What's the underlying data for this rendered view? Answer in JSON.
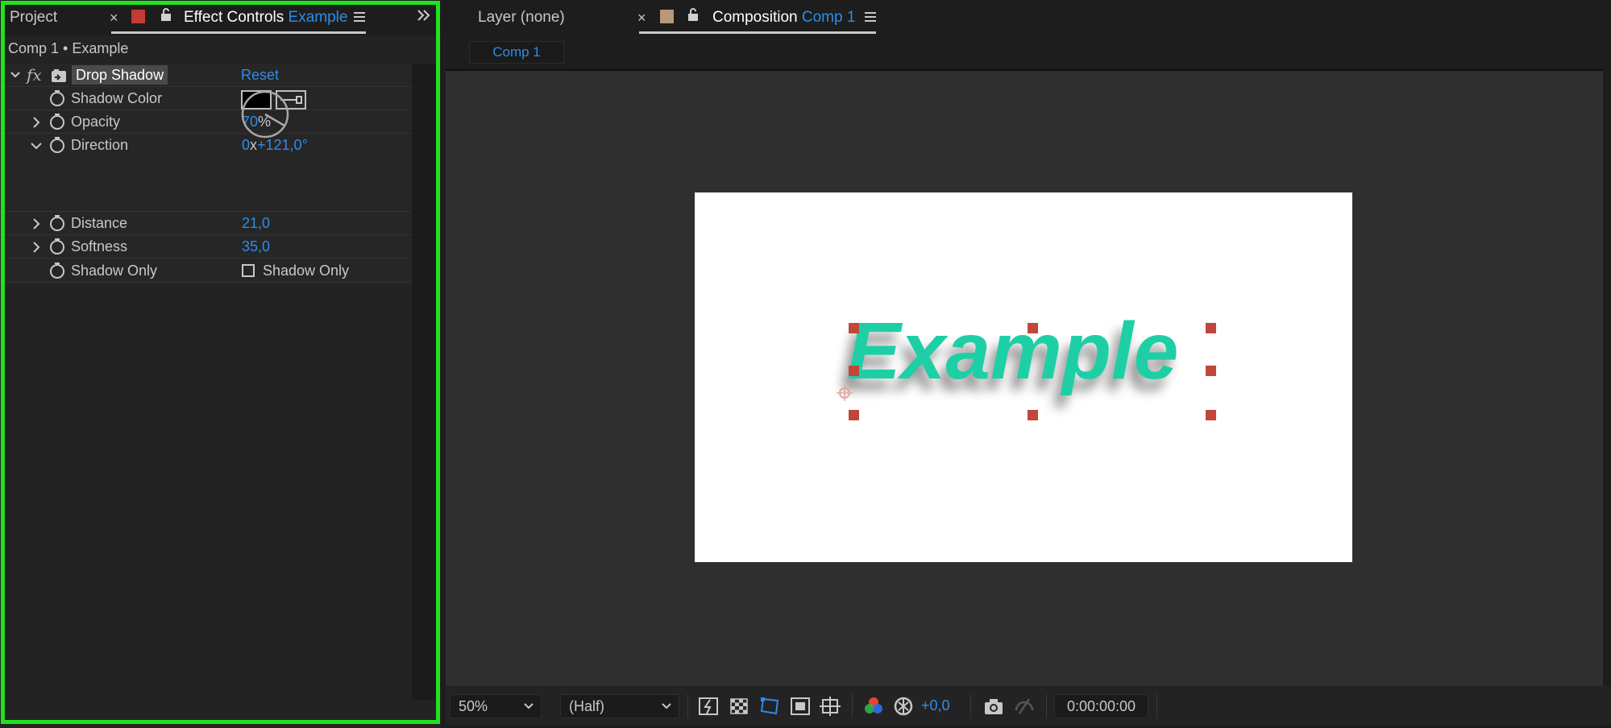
{
  "left_panel": {
    "tabs": {
      "project": "Project",
      "effect_controls": "Effect Controls",
      "effect_layer": "Example"
    },
    "comp_path": "Comp 1 • Example",
    "effect": {
      "name": "Drop Shadow",
      "reset": "Reset",
      "fx": "fx"
    },
    "properties": {
      "shadow_color": "Shadow Color",
      "opacity": {
        "label": "Opacity",
        "value": "70",
        "unit": "%"
      },
      "direction": {
        "label": "Direction",
        "revolutions": "0",
        "x": "x",
        "degrees": "+121,0°"
      },
      "distance": {
        "label": "Distance",
        "value": "21,0"
      },
      "softness": {
        "label": "Softness",
        "value": "35,0"
      },
      "shadow_only": {
        "label": "Shadow Only",
        "checkbox_label": "Shadow Only"
      }
    }
  },
  "right_panel": {
    "tabs": {
      "layer": "Layer (none)",
      "composition": "Composition",
      "comp_name": "Comp 1"
    },
    "sub_tab": "Comp 1",
    "canvas_text": "Example",
    "bottom_bar": {
      "zoom": "50%",
      "resolution": "(Half)",
      "exposure": "+0,0",
      "timecode": "0:00:00:00"
    }
  },
  "colors": {
    "accent_blue": "#2d8ceb",
    "text_teal": "#1ecfa6",
    "highlight_green": "#1fe21f",
    "handle_red": "#c0473a"
  }
}
